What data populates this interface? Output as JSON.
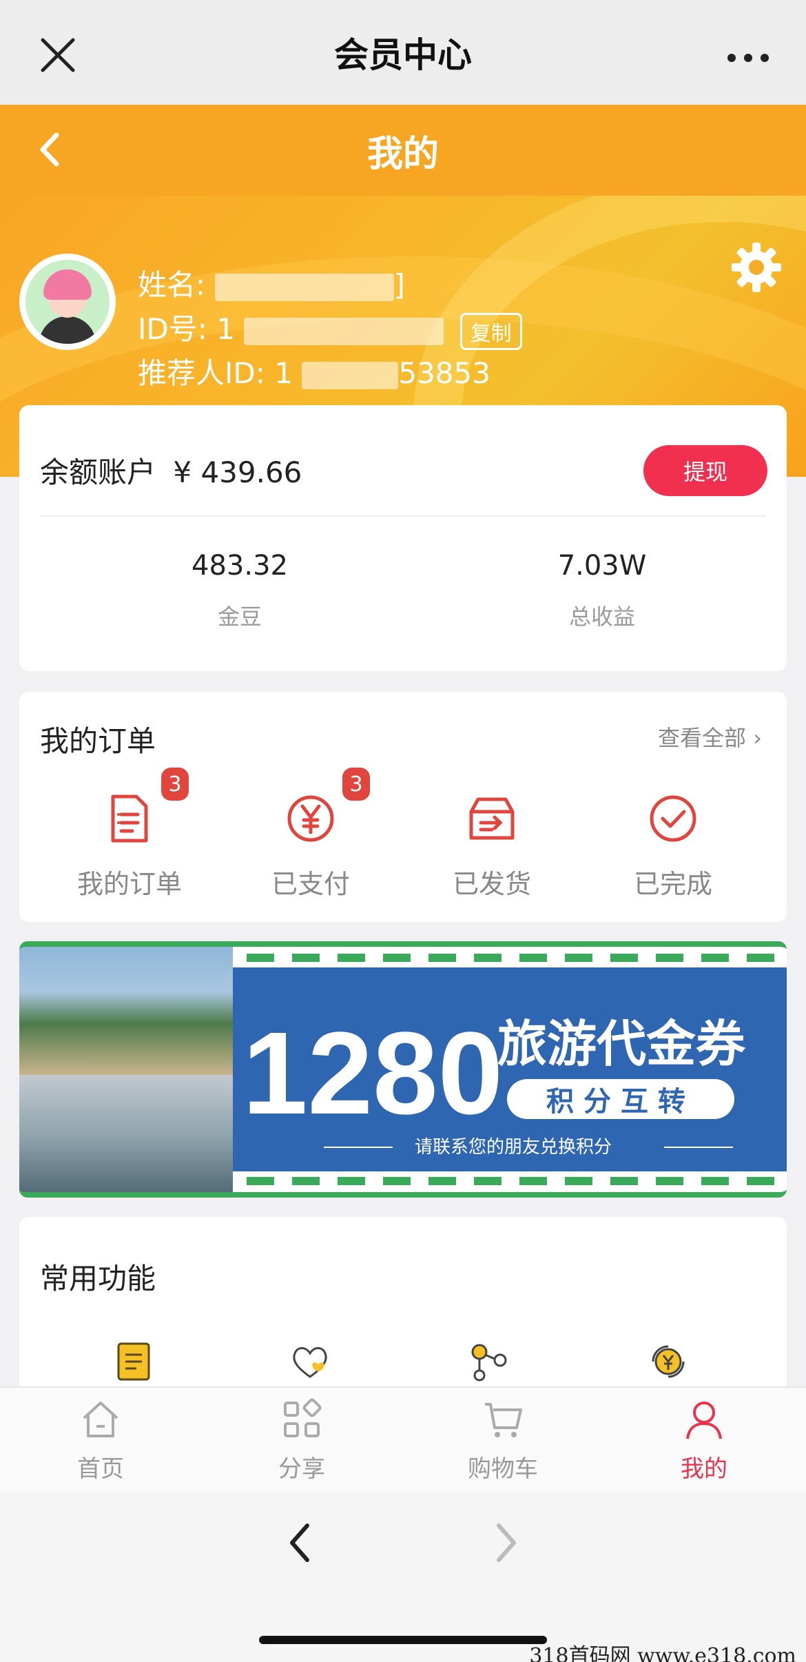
{
  "wechat_bar": {
    "title": "会员中心"
  },
  "page_header": {
    "title": "我的"
  },
  "profile": {
    "name_label": "姓名:",
    "name_value_tail": "]",
    "id_label": "ID号: 1",
    "copy_label": "复制",
    "referrer_label": "推荐人ID: 1",
    "referrer_tail": "53853"
  },
  "balance": {
    "label": "余额账户",
    "amount": "¥ 439.66",
    "withdraw_label": "提现",
    "stats": [
      {
        "value": "483.32",
        "label": "金豆"
      },
      {
        "value": "7.03W",
        "label": "总收益"
      }
    ]
  },
  "orders": {
    "title": "我的订单",
    "view_all": "查看全部 ›",
    "items": [
      {
        "label": "我的订单",
        "badge": "3"
      },
      {
        "label": "已支付",
        "badge": "3"
      },
      {
        "label": "已发货"
      },
      {
        "label": "已完成"
      }
    ]
  },
  "banner": {
    "amount": "1280",
    "title": "旅游代金券",
    "pill": "积分互转",
    "subtitle": "请联系您的朋友兑换积分"
  },
  "functions": {
    "title": "常用功能"
  },
  "tabbar": {
    "items": [
      {
        "label": "首页"
      },
      {
        "label": "分享"
      },
      {
        "label": "购物车"
      },
      {
        "label": "我的"
      }
    ],
    "active_color": "#e8344e"
  },
  "watermark": "318首码网  www.e318.com",
  "colors": {
    "orange": "#f6a623",
    "red": "#f0304e",
    "banner_blue": "#2f66b2",
    "banner_green": "#3aa95a"
  }
}
